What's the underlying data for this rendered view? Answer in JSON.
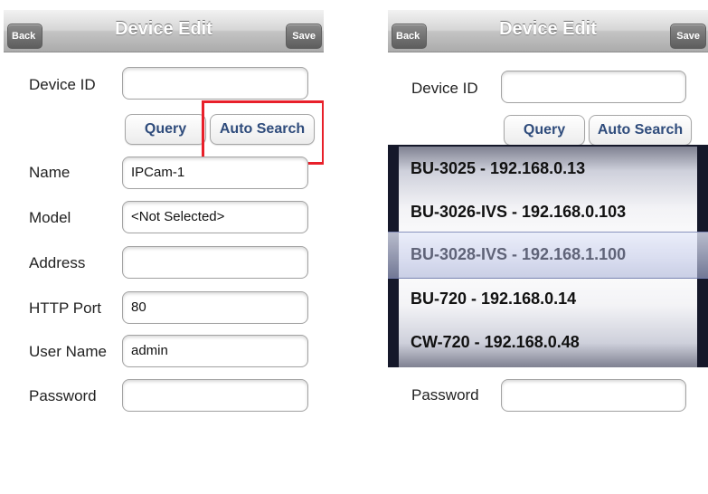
{
  "left": {
    "nav": {
      "back": "Back",
      "title": "Device Edit",
      "save": "Save"
    },
    "fields": {
      "device_id": {
        "label": "Device ID",
        "value": ""
      },
      "name": {
        "label": "Name",
        "value": "IPCam-1"
      },
      "model": {
        "label": "Model",
        "value": "<Not Selected>"
      },
      "address": {
        "label": "Address",
        "value": ""
      },
      "http_port": {
        "label": "HTTP Port",
        "value": "80"
      },
      "user_name": {
        "label": "User Name",
        "value": "admin"
      },
      "password": {
        "label": "Password",
        "value": ""
      }
    },
    "buttons": {
      "query": "Query",
      "auto_search": "Auto Search"
    }
  },
  "right": {
    "nav": {
      "back": "Back",
      "title": "Device Edit",
      "save": "Save"
    },
    "fields": {
      "device_id": {
        "label": "Device ID",
        "value": ""
      },
      "password": {
        "label": "Password",
        "value": ""
      }
    },
    "buttons": {
      "query": "Query",
      "auto_search": "Auto Search"
    },
    "picker": {
      "items": [
        "BU-3025 - 192.168.0.13",
        "BU-3026-IVS - 192.168.0.103",
        "BU-3028-IVS - 192.168.1.100",
        "BU-720 - 192.168.0.14",
        "CW-720 - 192.168.0.48"
      ],
      "selected_index": 2
    }
  },
  "colors": {
    "highlight_box": "#e8202a",
    "button_text": "#2f4c7c",
    "nav_title": "#ffffff"
  }
}
